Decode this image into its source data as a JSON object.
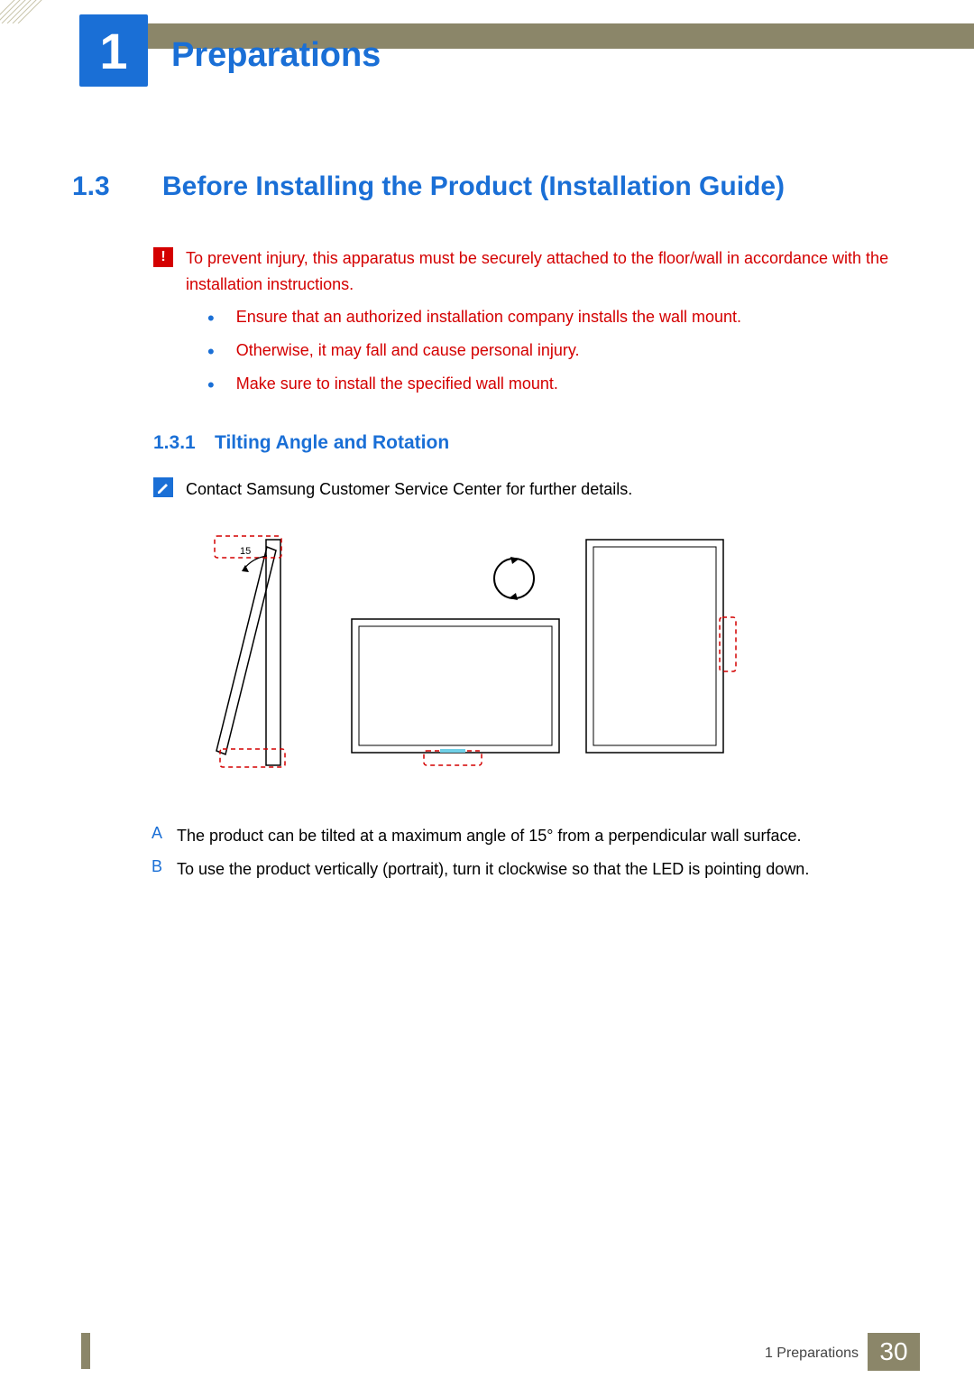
{
  "header": {
    "chapter_number": "1",
    "chapter_title": "Preparations"
  },
  "section": {
    "number": "1.3",
    "title": "Before Installing the Product (Installation Guide)"
  },
  "warning": {
    "text": "To prevent injury, this apparatus must be securely attached to the floor/wall in accordance with the installation instructions.",
    "bullets": [
      "Ensure that an authorized installation company installs the wall mount.",
      "Otherwise, it may fall and cause personal injury.",
      "Make sure to install the specified wall mount."
    ]
  },
  "subsection": {
    "number": "1.3.1",
    "title": "Tilting Angle and Rotation"
  },
  "note": {
    "text": "Contact Samsung Customer Service Center for further details."
  },
  "diagram": {
    "tilt_angle_label": "15"
  },
  "letters": {
    "a_label": "A",
    "a_text": "The product can be tilted at a maximum angle of 15° from a perpendicular wall surface.",
    "b_label": "B",
    "b_text": "To use the product vertically (portrait), turn it clockwise so that the LED is pointing down."
  },
  "footer": {
    "label": "1 Preparations",
    "page": "30"
  }
}
